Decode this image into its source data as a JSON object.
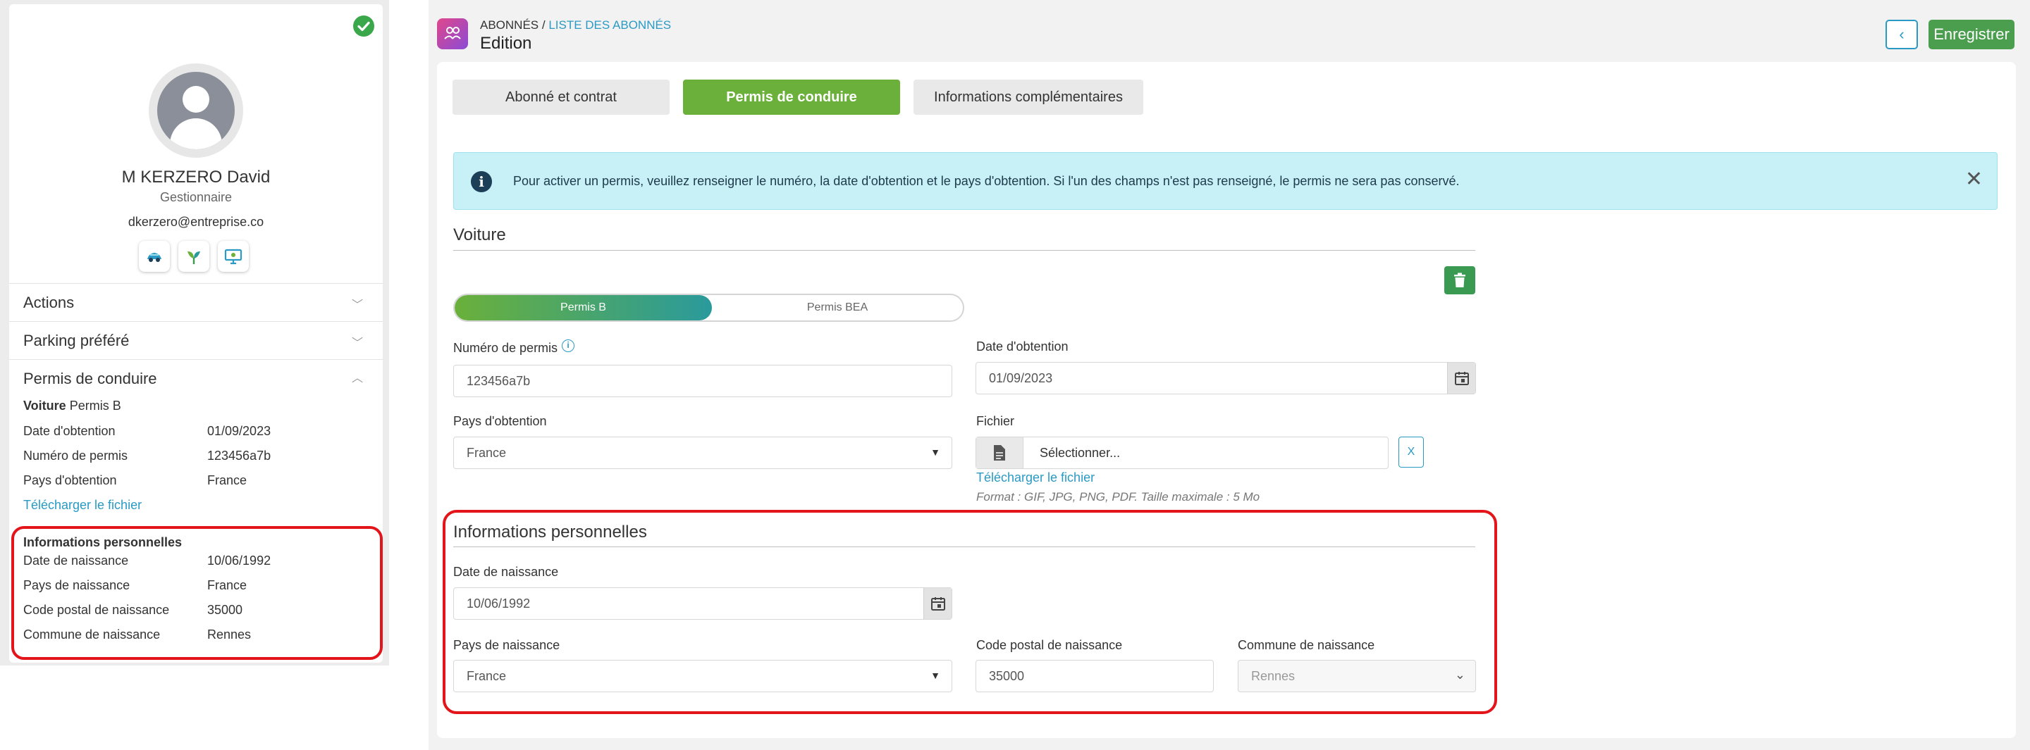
{
  "profile": {
    "name": "M KERZERO David",
    "role": "Gestionnaire",
    "email": "dkerzero@entreprise.co",
    "status_icon": "check-circle-icon",
    "status_color": "#3aa84a",
    "apps": [
      "app-car-icon",
      "app-leaf-icon",
      "app-monitor-icon"
    ]
  },
  "accordion": {
    "actions": "Actions",
    "parking": "Parking préféré",
    "permis": "Permis de conduire"
  },
  "summary": {
    "vehicle_label": "Voiture",
    "vehicle_type": "Permis B",
    "rows": [
      {
        "label": "Date d'obtention",
        "value": "01/09/2023"
      },
      {
        "label": "Numéro de permis",
        "value": "123456a7b"
      },
      {
        "label": "Pays d'obtention",
        "value": "France"
      }
    ],
    "download_link": "Télécharger le fichier",
    "personal_title": "Informations personnelles",
    "personal_rows": [
      {
        "label": "Date de naissance",
        "value": "10/06/1992"
      },
      {
        "label": "Pays de naissance",
        "value": "France"
      },
      {
        "label": "Code postal de naissance",
        "value": "35000"
      },
      {
        "label": "Commune de naissance",
        "value": "Rennes"
      }
    ]
  },
  "header": {
    "breadcrumb_root": "ABONNÉS",
    "breadcrumb_sep": " / ",
    "breadcrumb_link": "LISTE DES ABONNÉS",
    "title": "Edition",
    "back_label": "‹",
    "save_label": "Enregistrer"
  },
  "tabs": [
    {
      "label": "Abonné et contrat",
      "active": false
    },
    {
      "label": "Permis de conduire",
      "active": true
    },
    {
      "label": "Informations complémentaires",
      "active": false
    }
  ],
  "alert": {
    "text": "Pour activer un permis, veuillez renseigner le numéro, la date d'obtention et le pays d'obtention. Si l'un des champs n'est pas renseigné, le permis ne sera pas conservé.",
    "icon": "i",
    "close": "✕"
  },
  "voiture": {
    "title": "Voiture",
    "toggle": {
      "on": "Permis B",
      "off": "Permis BEA"
    },
    "numero_label": "Numéro de permis",
    "numero_value": "123456a7b",
    "date_label": "Date d'obtention",
    "date_value": "01/09/2023",
    "pays_label": "Pays d'obtention",
    "pays_value": "France",
    "fichier_label": "Fichier",
    "fichier_button": "Sélectionner...",
    "fichier_clear": "X",
    "fichier_link": "Télécharger le fichier",
    "fichier_hint": "Format : GIF, JPG, PNG, PDF. Taille maximale : 5 Mo"
  },
  "personal": {
    "title": "Informations personnelles",
    "birth_date_label": "Date de naissance",
    "birth_date_value": "10/06/1992",
    "birth_country_label": "Pays de naissance",
    "birth_country_value": "France",
    "postal_label": "Code postal de naissance",
    "postal_value": "35000",
    "city_label": "Commune de naissance",
    "city_value": "Rennes"
  },
  "colors": {
    "accent_green": "#6ab03a",
    "link_blue": "#2a9ac4",
    "highlight_red": "#e3151b",
    "alert_bg": "#c7f1f7"
  }
}
